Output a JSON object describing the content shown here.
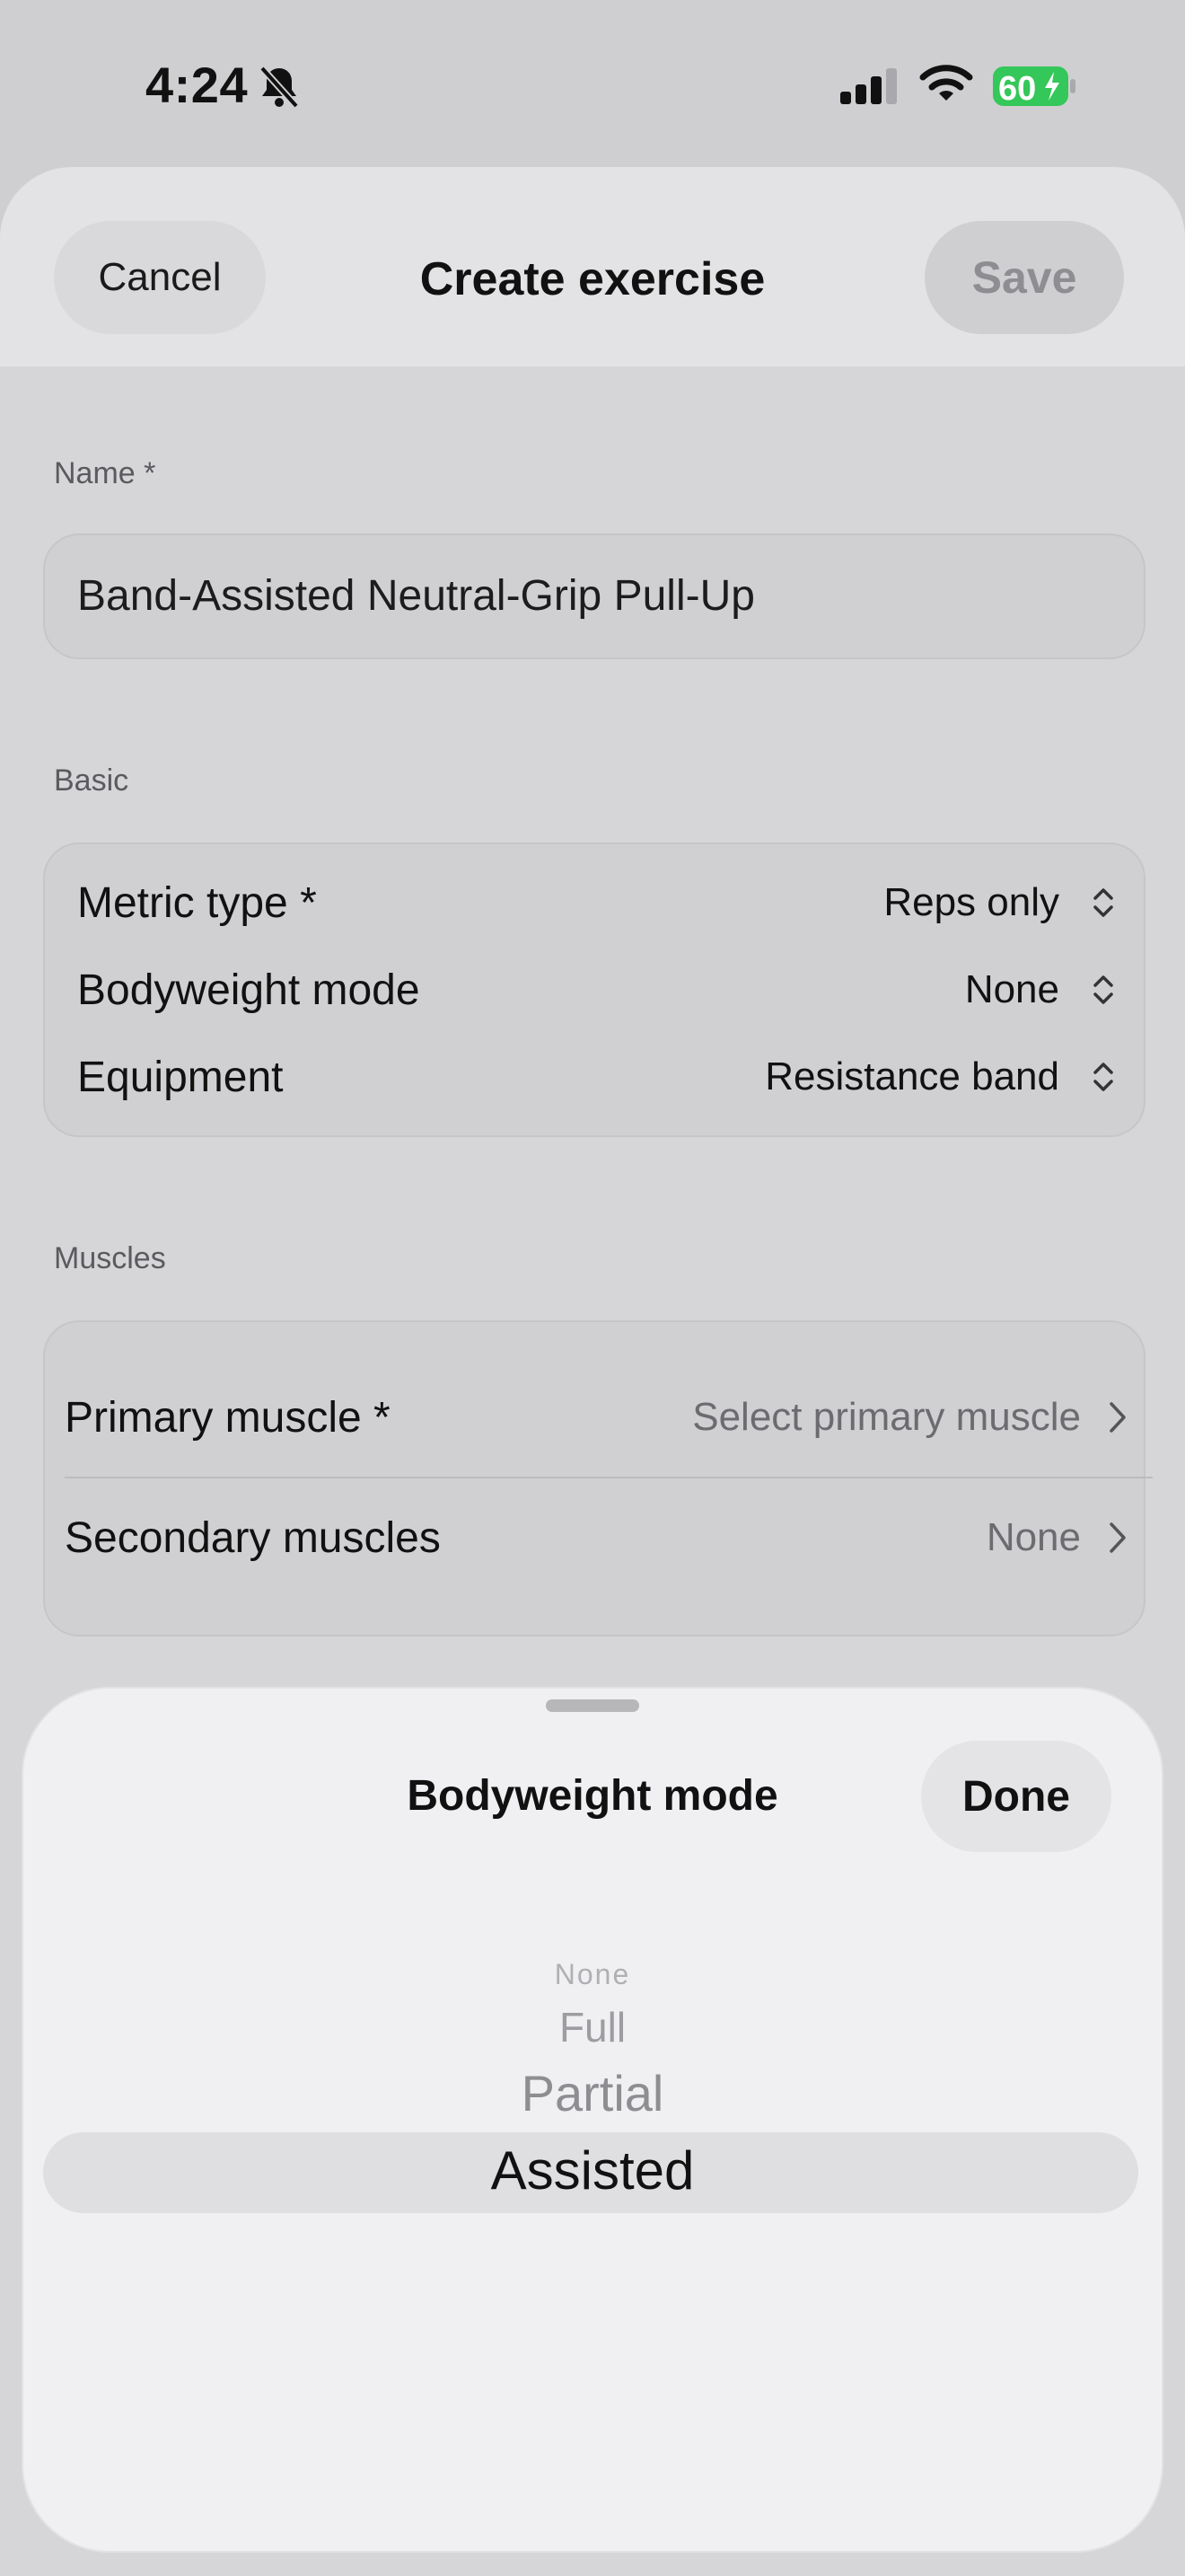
{
  "status_bar": {
    "time": "4:24",
    "battery": "60",
    "icons": [
      "bell-slash-icon",
      "cellular-signal-icon",
      "wifi-icon",
      "battery-charging-icon"
    ],
    "battery_color": "#34c759"
  },
  "header": {
    "cancel_label": "Cancel",
    "title": "Create exercise",
    "save_label": "Save"
  },
  "name_section": {
    "label": "Name *",
    "value": "Band-Assisted Neutral-Grip Pull-Up"
  },
  "basic_section": {
    "label": "Basic",
    "rows": [
      {
        "label": "Metric type *",
        "value": "Reps only"
      },
      {
        "label": "Bodyweight mode",
        "value": "None"
      },
      {
        "label": "Equipment",
        "value": "Resistance band"
      }
    ]
  },
  "muscles_section": {
    "label": "Muscles",
    "rows": [
      {
        "label": "Primary muscle *",
        "value": "Select primary muscle"
      },
      {
        "label": "Secondary muscles",
        "value": "None"
      }
    ]
  },
  "picker": {
    "title": "Bodyweight mode",
    "done_label": "Done",
    "options": [
      "None",
      "Full",
      "Partial",
      "Assisted"
    ],
    "selected": "Assisted"
  }
}
